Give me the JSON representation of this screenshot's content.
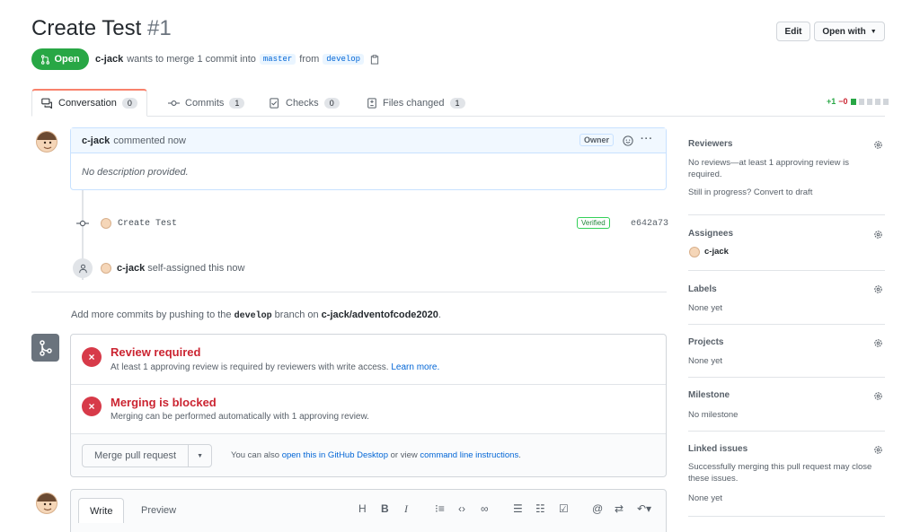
{
  "header": {
    "title": "Create Test",
    "number": "#1",
    "edit_label": "Edit",
    "open_with_label": "Open with",
    "state": "Open",
    "author": "c-jack",
    "meta_text": "wants to merge 1 commit into",
    "base_branch": "master",
    "from_text": "from",
    "head_branch": "develop"
  },
  "tabs": [
    {
      "label": "Conversation",
      "count": "0"
    },
    {
      "label": "Commits",
      "count": "1"
    },
    {
      "label": "Checks",
      "count": "0"
    },
    {
      "label": "Files changed",
      "count": "1"
    }
  ],
  "diffstat": {
    "additions": "+1",
    "deletions": "−0"
  },
  "comment": {
    "author": "c-jack",
    "action": "commented now",
    "role": "Owner",
    "body": "No description provided."
  },
  "commit": {
    "message": "Create Test",
    "verified_label": "Verified",
    "sha": "e642a73"
  },
  "assign_event": {
    "actor": "c-jack",
    "text": "self-assigned this now"
  },
  "push_hint": {
    "prefix": "Add more commits by pushing to the",
    "branch": "develop",
    "middle": "branch on",
    "repo": "c-jack/adventofcode2020",
    "suffix": "."
  },
  "merge": {
    "review_title": "Review required",
    "review_desc": "At least 1 approving review is required by reviewers with write access.",
    "learn_more": "Learn more.",
    "blocked_title": "Merging is blocked",
    "blocked_desc": "Merging can be performed automatically with 1 approving review.",
    "merge_button": "Merge pull request",
    "also_text": "You can also",
    "desktop_link": "open this in GitHub Desktop",
    "or_text": "or view",
    "cli_link": "command line instructions",
    "period": "."
  },
  "editor": {
    "write_tab": "Write",
    "preview_tab": "Preview",
    "tool_heading": "H",
    "tool_bold": "B",
    "tool_italic": "I",
    "tool_mention": "@"
  },
  "sidebar": {
    "reviewers_title": "Reviewers",
    "reviewers_body": "No reviews—at least 1 approving review is required.",
    "reviewers_draft": "Still in progress? Convert to draft",
    "assignees_title": "Assignees",
    "assignee": "c-jack",
    "labels_title": "Labels",
    "labels_body": "None yet",
    "projects_title": "Projects",
    "projects_body": "None yet",
    "milestone_title": "Milestone",
    "milestone_body": "No milestone",
    "linked_title": "Linked issues",
    "linked_body": "Successfully merging this pull request may close these issues.",
    "linked_none": "None yet"
  },
  "colors": {
    "open": "#28a745",
    "danger": "#d73a49",
    "link": "#0366d6",
    "tab_accent": "#f9826c"
  }
}
